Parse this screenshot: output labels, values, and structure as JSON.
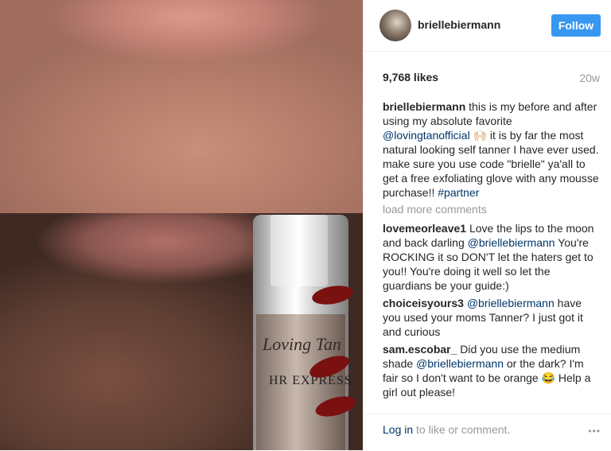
{
  "header": {
    "username": "briellebiermann",
    "follow_label": "Follow"
  },
  "stats": {
    "likes": "9,768 likes",
    "age": "20w"
  },
  "caption": {
    "username": "briellebiermann",
    "text_before": " this is my before and after using my absolute favorite ",
    "mention": "@lovingtanofficial",
    "emoji": " 🙌🏻",
    "text_after": " it is by far the most natural looking self tanner I have ever used. make sure you use code \"brielle\" ya'all to get a free exfoliating glove with any mousse purchase!! ",
    "hashtag": "#partner"
  },
  "load_more": "load more comments",
  "comments": [
    {
      "username": "lovemeorleave1",
      "text_before": " Love the lips to the moon and back darling ",
      "mention": "@briellebiermann",
      "text_after": " You're ROCKING it so DON'T let the haters get to you!! You're doing it well so let the guardians be your guide:)"
    },
    {
      "username": "choiceisyours3",
      "text_before": " ",
      "mention": "@briellebiermann",
      "text_after": " have you used your moms Tanner? I just got it and curious"
    },
    {
      "username": "sam.escobar_",
      "text_before": " Did you use the medium shade ",
      "mention": "@briellebiermann",
      "text_after": " or the dark? I'm fair so I don't want to be orange 😂 Help a girl out please!"
    }
  ],
  "footer": {
    "login_link": "Log in",
    "login_rest": " to like or comment.",
    "more_icon": "•••"
  },
  "photo": {
    "bottle_brand": "Loving Tan",
    "bottle_product": "HR EXPRESS"
  }
}
